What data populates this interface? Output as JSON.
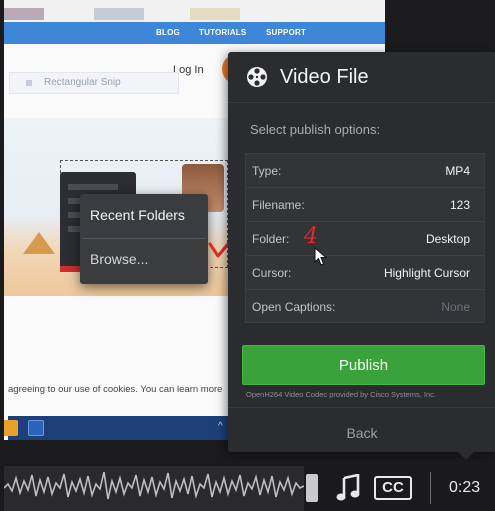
{
  "website": {
    "nav_links": [
      "BLOG",
      "TUTORIALS",
      "SUPPORT"
    ],
    "login_label": "Log In",
    "snip_label": "Rectangular Snip",
    "cookie_text": "agreeing to our use of cookies. You can learn more"
  },
  "context_menu": {
    "items": [
      "Recent Folders",
      "Browse..."
    ]
  },
  "annotation": {
    "number": "4",
    "color": "#e02a2a"
  },
  "panel": {
    "title": "Video File",
    "subtitle": "Select publish options:",
    "options": [
      {
        "label": "Type:",
        "value": "MP4"
      },
      {
        "label": "Filename:",
        "value": "123"
      },
      {
        "label": "Folder:",
        "value": "Desktop"
      },
      {
        "label": "Cursor:",
        "value": "Highlight Cursor"
      },
      {
        "label": "Open Captions:",
        "value": "None"
      }
    ],
    "publish_label": "Publish",
    "codec_note": "OpenH264 Video Codec provided by Cisco Systems, Inc.",
    "back_label": "Back",
    "accent": "#3aa23a"
  },
  "player": {
    "cc_label": "CC",
    "time": "0:23"
  }
}
